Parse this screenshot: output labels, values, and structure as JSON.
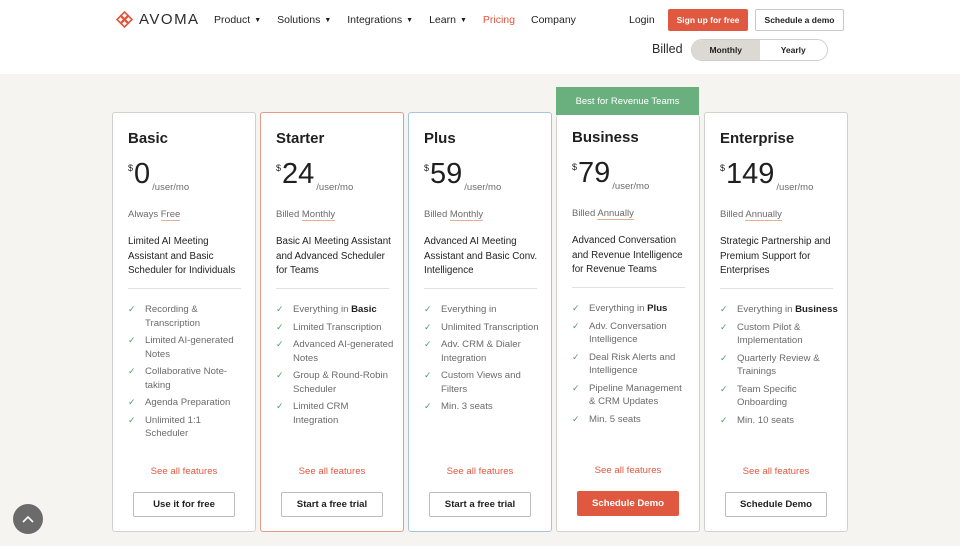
{
  "header": {
    "logo_text": "AVOMA",
    "nav": [
      {
        "label": "Product",
        "dropdown": true
      },
      {
        "label": "Solutions",
        "dropdown": true
      },
      {
        "label": "Integrations",
        "dropdown": true
      },
      {
        "label": "Learn",
        "dropdown": true
      },
      {
        "label": "Pricing",
        "dropdown": false
      },
      {
        "label": "Company",
        "dropdown": false
      }
    ],
    "login_label": "Login",
    "signup_label": "Sign up for free",
    "schedule_label": "Schedule a demo"
  },
  "billing": {
    "label": "Billed",
    "options": [
      "Monthly",
      "Yearly"
    ],
    "selected": "Monthly"
  },
  "badge": "Best for Revenue Teams",
  "plans": [
    {
      "name": "Basic",
      "currency": "$",
      "price": "0",
      "unit": "/user/mo",
      "billing_prefix": "Always",
      "billing_term": "Free",
      "description": "Limited AI Meeting Assistant and Basic Scheduler for Individuals",
      "features": [
        {
          "text": "Recording & Transcription"
        },
        {
          "text": "Limited AI-generated Notes"
        },
        {
          "text": "Collaborative Note-taking"
        },
        {
          "text": "Agenda Preparation"
        },
        {
          "text": "Unlimited 1:1 Scheduler"
        }
      ],
      "see_all": "See all features",
      "cta": "Use it for free"
    },
    {
      "name": "Starter",
      "currency": "$",
      "price": "24",
      "unit": "/user/mo",
      "billing_prefix": "Billed",
      "billing_term": "Monthly",
      "description": "Basic AI Meeting Assistant and Advanced Scheduler for Teams",
      "features": [
        {
          "text": "Everything in ",
          "bold": "Basic"
        },
        {
          "text": "Limited Transcription"
        },
        {
          "text": "Advanced AI-generated Notes"
        },
        {
          "text": "Group & Round-Robin Scheduler"
        },
        {
          "text": "Limited CRM Integration"
        }
      ],
      "see_all": "See all features",
      "cta": "Start a free trial"
    },
    {
      "name": "Plus",
      "currency": "$",
      "price": "59",
      "unit": "/user/mo",
      "billing_prefix": "Billed",
      "billing_term": "Monthly",
      "description": "Advanced AI Meeting Assistant and Basic Conv. Intelligence",
      "features": [
        {
          "text": "Everything in"
        },
        {
          "text": "Unlimited Transcription"
        },
        {
          "text": "Adv. CRM & Dialer Integration"
        },
        {
          "text": "Custom Views and Filters"
        },
        {
          "text": "Min. 3 seats"
        }
      ],
      "see_all": "See all features",
      "cta": "Start a free trial"
    },
    {
      "name": "Business",
      "currency": "$",
      "price": "79",
      "unit": "/user/mo",
      "billing_prefix": "Billed",
      "billing_term": "Annually",
      "description": "Advanced Conversation and Revenue Intelligence for Revenue Teams",
      "features": [
        {
          "text": "Everything in ",
          "bold": "Plus"
        },
        {
          "text": "Adv. Conversation Intelligence"
        },
        {
          "text": "Deal Risk Alerts and Intelligence"
        },
        {
          "text": "Pipeline Management & CRM Updates"
        },
        {
          "text": "Min. 5 seats"
        }
      ],
      "see_all": "See all features",
      "cta": "Schedule Demo"
    },
    {
      "name": "Enterprise",
      "currency": "$",
      "price": "149",
      "unit": "/user/mo",
      "billing_prefix": "Billed",
      "billing_term": "Annually",
      "description": "Strategic Partnership and Premium Support for Enterprises",
      "features": [
        {
          "text": "Everything in ",
          "bold": "Business"
        },
        {
          "text": "Custom Pilot & Implementation"
        },
        {
          "text": "Quarterly Review & Trainings"
        },
        {
          "text": "Team Specific Onboarding"
        },
        {
          "text": "Min. 10 seats"
        }
      ],
      "see_all": "See all features",
      "cta": "Schedule Demo"
    }
  ],
  "colors": {
    "accent": "#e0583f",
    "badge_green": "#6ab07e",
    "check_green": "#4e9a67"
  }
}
